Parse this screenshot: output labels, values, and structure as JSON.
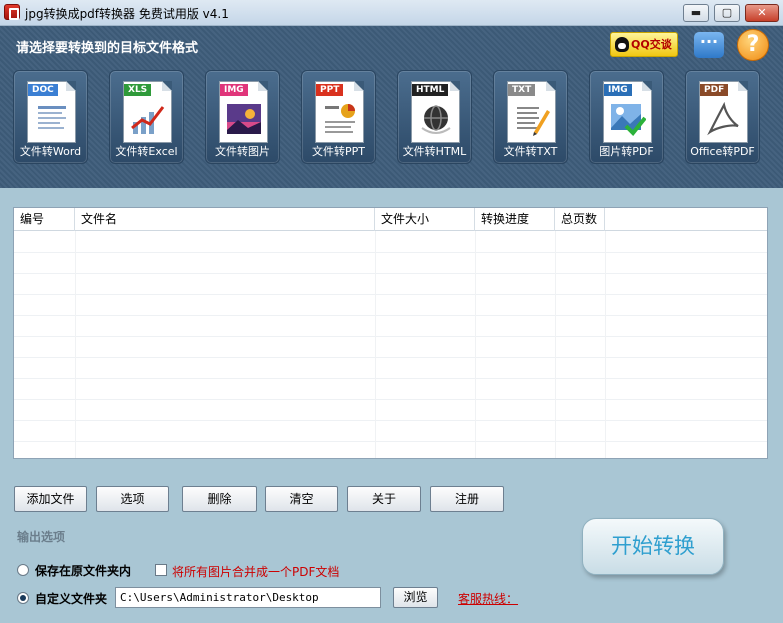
{
  "window": {
    "title": "jpg转换成pdf转换器 免费试用版 v4.1",
    "min_glyph": "▬",
    "max_glyph": "▢",
    "close_glyph": "✕"
  },
  "header": {
    "title": "请选择要转换到的目标文件格式",
    "qq_label": "QQ交谈",
    "chat_glyph": "···",
    "help_glyph": "?",
    "tiles": [
      {
        "tag": "DOC",
        "label": "文件转Word",
        "tag_color": "#3b7fd3",
        "icon": "word-document-icon"
      },
      {
        "tag": "XLS",
        "label": "文件转Excel",
        "tag_color": "#2f9a3a",
        "icon": "excel-chart-icon"
      },
      {
        "tag": "IMG",
        "label": "文件转图片",
        "tag_color": "#e0357a",
        "icon": "image-landscape-icon"
      },
      {
        "tag": "PPT",
        "label": "文件转PPT",
        "tag_color": "#d9311e",
        "icon": "powerpoint-slide-icon"
      },
      {
        "tag": "HTML",
        "label": "文件转HTML",
        "tag_color": "#222222",
        "icon": "html-globe-icon"
      },
      {
        "tag": "TXT",
        "label": "文件转TXT",
        "tag_color": "#8a8a8a",
        "icon": "text-pencil-icon"
      },
      {
        "tag": "IMG",
        "label": "图片转PDF",
        "tag_color": "#2a6fb7",
        "icon": "image-check-icon"
      },
      {
        "tag": "PDF",
        "label": "Office转PDF",
        "tag_color": "#8a4a28",
        "icon": "pdf-acrobat-icon"
      }
    ]
  },
  "table": {
    "columns": [
      "编号",
      "文件名",
      "文件大小",
      "转换进度",
      "总页数"
    ],
    "rows": []
  },
  "toolbar": {
    "add": "添加文件",
    "options": "选项",
    "delete": "删除",
    "clear": "清空",
    "about": "关于",
    "register": "注册"
  },
  "output": {
    "section_label": "输出选项",
    "save_original": "保存在原文件夹内",
    "merge_label": "将所有图片合并成一个PDF文档",
    "custom_folder": "自定义文件夹",
    "path": "C:\\Users\\Administrator\\Desktop",
    "browse": "浏览",
    "hotline": "客服热线：",
    "start": "开始转换",
    "save_original_checked": false,
    "custom_folder_checked": true,
    "merge_checked": false
  }
}
